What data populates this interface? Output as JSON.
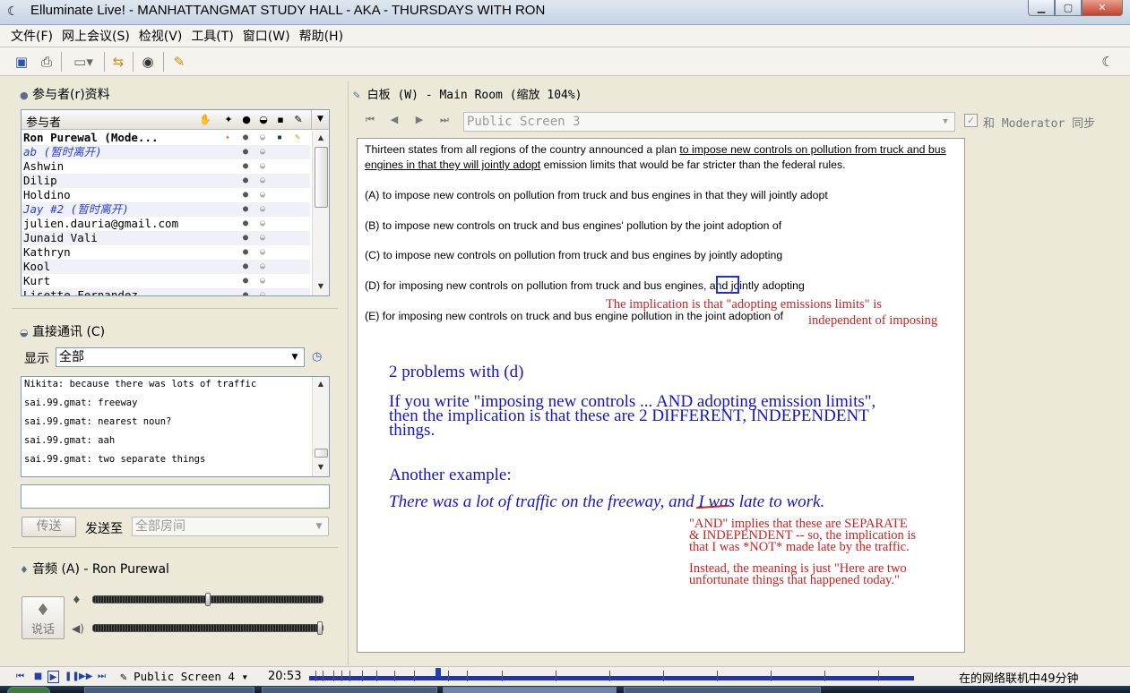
{
  "window": {
    "title": "Elluminate Live! - MANHATTANGMAT STUDY HALL - AKA - THURSDAYS WITH RON"
  },
  "menu": [
    "文件(F)",
    "网上会议(S)",
    "检视(V)",
    "工具(T)",
    "窗口(W)",
    "帮助(H)"
  ],
  "participants": {
    "panel_title": "参与者(r)资料",
    "header": "参与者",
    "rows": [
      {
        "name": "Ron Purewal (Mode...",
        "style": "bold"
      },
      {
        "name": "ab (暂时离开)",
        "style": "away"
      },
      {
        "name": "Ashwin",
        "style": "normal"
      },
      {
        "name": "Dilip",
        "style": "normal"
      },
      {
        "name": "Holdino",
        "style": "normal"
      },
      {
        "name": "Jay #2 (暂时离开)",
        "style": "away"
      },
      {
        "name": "julien.dauria@gmail.com",
        "style": "normal"
      },
      {
        "name": "Junaid Vali",
        "style": "normal"
      },
      {
        "name": "Kathryn",
        "style": "normal"
      },
      {
        "name": "Kool",
        "style": "normal"
      },
      {
        "name": "Kurt",
        "style": "normal"
      },
      {
        "name": "Lisette Fernandez",
        "style": "normal"
      }
    ]
  },
  "chat": {
    "panel_title": "直接通讯 (C)",
    "show_label": "显示",
    "filter_value": "全部",
    "messages": [
      "Nikita: because there was lots of traffic",
      "sai.99.gmat: freeway",
      "sai.99.gmat: nearest noun?",
      "sai.99.gmat: aah",
      "sai.99.gmat: two separate things"
    ],
    "input_value": "",
    "send_label": "传送",
    "send_to_label": "发送至",
    "send_to_value": "全部房间"
  },
  "audio": {
    "panel_title": "音频 (A) - Ron Purewal",
    "talk_label": "说话",
    "mic_level": 0.5,
    "speaker_level": 1.0
  },
  "whiteboard": {
    "panel_title": "白板 (W) - Main Room (缩放 104%)",
    "screen_select": "Public Screen 3",
    "sync_label": "和 Moderator 同步",
    "question": {
      "line1_a": "Thirteen states from all regions of the country announced a plan ",
      "line1_b": "to impose new controls on pollution from truck and bus",
      "line2_a": "engines in that they will jointly adopt",
      "line2_b": " emission limits that would be far stricter than the federal rules.",
      "options": [
        "(A) to impose new controls on pollution from truck and bus engines in that they will jointly adopt",
        "(B) to impose new controls on truck and bus engines' pollution by the joint adoption of",
        "(C) to impose new controls on pollution from truck and bus engines by jointly adopting",
        "(D) for imposing new controls on pollution from truck and bus engines, and jointly adopting",
        "(E) for imposing new controls on truck and bus engine pollution in the joint adoption of"
      ]
    },
    "red_note_1": [
      "The implication is that \"adopting emissions limits\" is",
      "independent of imposing"
    ],
    "blue_heading": "2 problems with (d)",
    "blue_para": [
      "If you write \"imposing new controls ... AND adopting emission limits\",",
      "then the implication is that these are 2 DIFFERENT, INDEPENDENT",
      "things."
    ],
    "blue_example_heading": "Another example:",
    "blue_example": "There was a lot of traffic on the freeway, and I was late to work.",
    "red_note_2": [
      "\"AND\" implies that these are SEPARATE",
      "& INDEPENDENT -- so, the implication is",
      "that I was *NOT* made late by the traffic."
    ],
    "red_note_3": [
      "Instead, the meaning is just \"Here are two",
      "unfortunate things that happened today.\""
    ]
  },
  "status": {
    "screen": "Public Screen 4",
    "time": "20:53",
    "connection": "在的网络联机中49分钟"
  }
}
